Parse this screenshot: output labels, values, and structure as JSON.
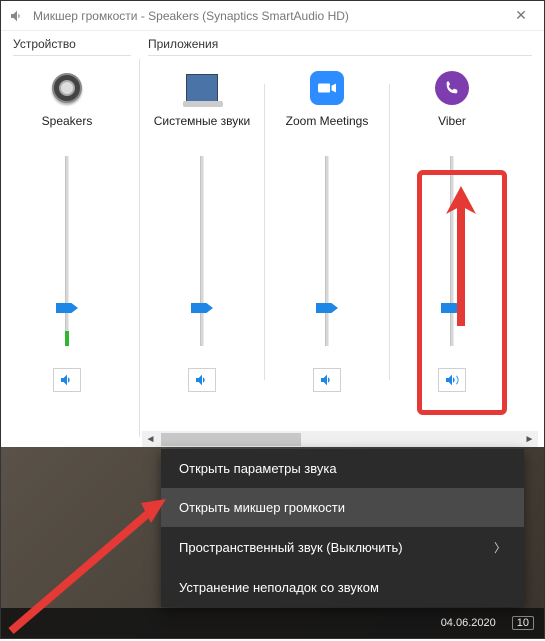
{
  "window": {
    "title": "Микшер громкости - Speakers (Synaptics SmartAudio HD)"
  },
  "sections": {
    "device_label": "Устройство",
    "apps_label": "Приложения"
  },
  "channels": {
    "device": {
      "name": "Speakers",
      "level_pct": 20,
      "meter_pct": 8
    },
    "apps": [
      {
        "name": "Системные звуки",
        "level_pct": 20,
        "meter_pct": 0,
        "icon": "system-sounds"
      },
      {
        "name": "Zoom Meetings",
        "level_pct": 20,
        "meter_pct": 0,
        "icon": "zoom"
      },
      {
        "name": "Viber",
        "level_pct": 20,
        "meter_pct": 0,
        "icon": "viber"
      }
    ]
  },
  "context_menu": {
    "items": [
      {
        "label": "Открыть параметры звука",
        "submenu": false,
        "hover": false
      },
      {
        "label": "Открыть микшер громкости",
        "submenu": false,
        "hover": true
      },
      {
        "label": "Пространственный звук (Выключить)",
        "submenu": true,
        "hover": false
      },
      {
        "label": "Устранение неполадок со звуком",
        "submenu": false,
        "hover": false
      }
    ]
  },
  "taskbar": {
    "date": "04.06.2020",
    "notif_count": "10"
  }
}
